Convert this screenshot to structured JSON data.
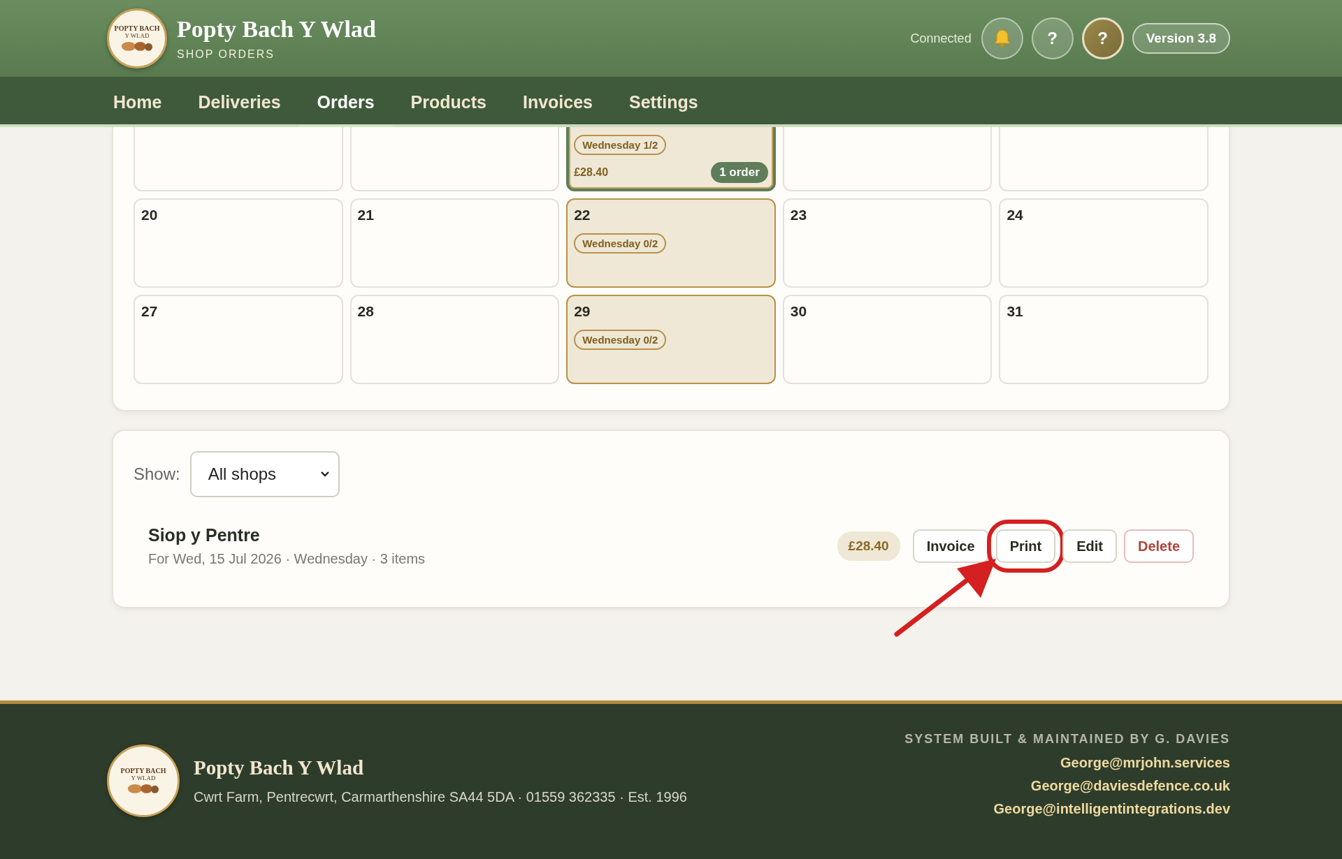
{
  "header": {
    "logo": {
      "line_1": "POPTY BACH",
      "line_2": "Y WLAD"
    },
    "title": "Popty Bach Y Wlad",
    "subtitle": "SHOP ORDERS",
    "status": "Connected",
    "buttons": [
      {
        "kind": "bell"
      },
      {
        "kind": "help",
        "label": "?"
      },
      {
        "kind": "avatar",
        "label": "?"
      }
    ],
    "version": "Version 3.8"
  },
  "nav": [
    {
      "label": "Home",
      "selected": false
    },
    {
      "label": "Deliveries",
      "selected": false
    },
    {
      "label": "Orders",
      "selected": true
    },
    {
      "label": "Products",
      "selected": false
    },
    {
      "label": "Invoices",
      "selected": false
    },
    {
      "label": "Settings",
      "selected": false
    }
  ],
  "calendar": {
    "weeks": [
      [
        {
          "delivery": false,
          "selected": false
        },
        {
          "delivery": false,
          "selected": false
        },
        {
          "delivery": true,
          "selected": true,
          "tag": "Wednesday 1/2",
          "total": "£28.40",
          "orders": "1 order"
        },
        {
          "delivery": false,
          "selected": false
        },
        {
          "delivery": false,
          "selected": false
        }
      ],
      [
        {
          "day": "20",
          "delivery": false,
          "selected": false
        },
        {
          "day": "21",
          "delivery": false,
          "selected": false
        },
        {
          "day": "22",
          "delivery": true,
          "selected": false,
          "tag": "Wednesday 0/2"
        },
        {
          "day": "23",
          "delivery": false,
          "selected": false
        },
        {
          "day": "24",
          "delivery": false,
          "selected": false
        }
      ],
      [
        {
          "day": "27",
          "delivery": false,
          "selected": false
        },
        {
          "day": "28",
          "delivery": false,
          "selected": false
        },
        {
          "day": "29",
          "delivery": true,
          "selected": false,
          "tag": "Wednesday 0/2"
        },
        {
          "day": "30",
          "delivery": false,
          "selected": false
        },
        {
          "day": "31",
          "delivery": false,
          "selected": false
        }
      ]
    ]
  },
  "filter": {
    "label": "Show:",
    "value": "All shops"
  },
  "orders": [
    {
      "shop": "Siop y Pentre",
      "details": "For Wed, 15 Jul 2026 · Wednesday · 3 items",
      "total": "£28.40",
      "actions": [
        {
          "label": "Invoice",
          "kind": "default",
          "highlighted": false
        },
        {
          "label": "Print",
          "kind": "default",
          "highlighted": true
        },
        {
          "label": "Edit",
          "kind": "default",
          "highlighted": false
        },
        {
          "label": "Delete",
          "kind": "danger",
          "highlighted": false
        }
      ]
    }
  ],
  "footer": {
    "logo": {
      "line_1": "POPTY BACH",
      "line_2": "Y WLAD"
    },
    "title": "Popty Bach Y Wlad",
    "address": "Cwrt Farm, Pentrecwrt, Carmarthenshire SA44 5DA · 01559 362335 · Est. 1996",
    "credit": "SYSTEM BUILT & MAINTAINED BY G. DAVIES",
    "emails": [
      "George@mrjohn.services",
      "George@daviesdefence.co.uk",
      "George@intelligentintegrations.dev"
    ]
  }
}
